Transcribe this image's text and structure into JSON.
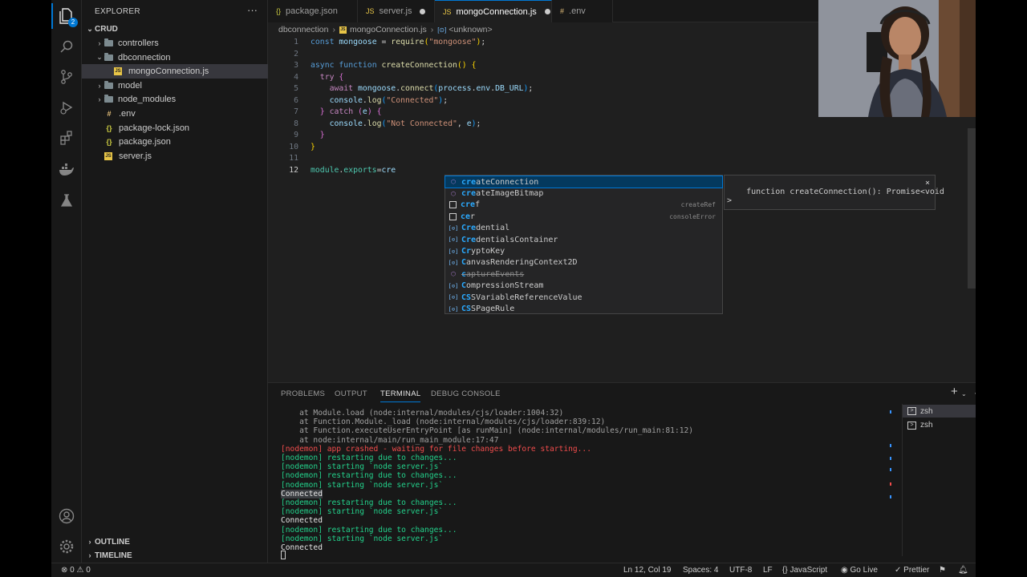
{
  "explorer": {
    "title": "EXPLORER",
    "more_label": "···",
    "badge_count": "2",
    "root_label": "CRUD",
    "items": [
      {
        "label": "controllers",
        "type": "folder",
        "expanded": false,
        "indent": 1
      },
      {
        "label": "dbconnection",
        "type": "folder",
        "expanded": true,
        "indent": 1
      },
      {
        "label": "mongoConnection.js",
        "type": "js",
        "indent": 2,
        "selected": true
      },
      {
        "label": "model",
        "type": "folder",
        "expanded": false,
        "indent": 1
      },
      {
        "label": "node_modules",
        "type": "folder",
        "expanded": false,
        "indent": 1
      },
      {
        "label": ".env",
        "type": "env",
        "indent": 1
      },
      {
        "label": "package-lock.json",
        "type": "json",
        "indent": 1
      },
      {
        "label": "package.json",
        "type": "json",
        "indent": 1
      },
      {
        "label": "server.js",
        "type": "js",
        "indent": 1
      }
    ],
    "outline_label": "OUTLINE",
    "timeline_label": "TIMELINE"
  },
  "tabs": [
    {
      "label": "package.json",
      "icon": "{}",
      "active": false,
      "dirty": false
    },
    {
      "label": "server.js",
      "icon": "JS",
      "active": false,
      "dirty": true
    },
    {
      "label": "mongoConnection.js",
      "icon": "JS",
      "active": true,
      "dirty": true
    },
    {
      "label": ".env",
      "icon": "#",
      "active": false,
      "dirty": false
    }
  ],
  "breadcrumb": {
    "folder": "dbconnection",
    "file": "mongoConnection.js",
    "symbol": "<unknown>"
  },
  "editor": {
    "cursor_line": 12,
    "lines": [
      {
        "n": "1",
        "tokens": [
          [
            "kw",
            "const"
          ],
          [
            "pl",
            " "
          ],
          [
            "var",
            "mongoose"
          ],
          [
            "pl",
            " = "
          ],
          [
            "fn",
            "require"
          ],
          [
            "br",
            "("
          ],
          [
            "str",
            "\"mongoose\""
          ],
          [
            "br",
            ")"
          ],
          [
            "pl",
            ";"
          ]
        ]
      },
      {
        "n": "2",
        "tokens": []
      },
      {
        "n": "3",
        "tokens": [
          [
            "kw",
            "async"
          ],
          [
            "pl",
            " "
          ],
          [
            "kw",
            "function"
          ],
          [
            "pl",
            " "
          ],
          [
            "fn",
            "createConnection"
          ],
          [
            "br",
            "()"
          ],
          [
            "pl",
            " "
          ],
          [
            "br",
            "{"
          ]
        ]
      },
      {
        "n": "4",
        "tokens": [
          [
            "pl",
            "  "
          ],
          [
            "kw2",
            "try"
          ],
          [
            "pl",
            " "
          ],
          [
            "br2",
            "{"
          ]
        ]
      },
      {
        "n": "5",
        "tokens": [
          [
            "pl",
            "    "
          ],
          [
            "kw2",
            "await"
          ],
          [
            "pl",
            " "
          ],
          [
            "var",
            "mongoose"
          ],
          [
            "pl",
            "."
          ],
          [
            "fn",
            "connect"
          ],
          [
            "br3",
            "("
          ],
          [
            "var",
            "process"
          ],
          [
            "pl",
            "."
          ],
          [
            "var",
            "env"
          ],
          [
            "pl",
            "."
          ],
          [
            "var",
            "DB_URL"
          ],
          [
            "br3",
            ")"
          ],
          [
            "pl",
            ";"
          ]
        ]
      },
      {
        "n": "6",
        "tokens": [
          [
            "pl",
            "    "
          ],
          [
            "var",
            "console"
          ],
          [
            "pl",
            "."
          ],
          [
            "fn",
            "log"
          ],
          [
            "br3",
            "("
          ],
          [
            "str",
            "\"Connected\""
          ],
          [
            "br3",
            ")"
          ],
          [
            "pl",
            ";"
          ]
        ]
      },
      {
        "n": "7",
        "tokens": [
          [
            "pl",
            "  "
          ],
          [
            "br2",
            "}"
          ],
          [
            "pl",
            " "
          ],
          [
            "kw2",
            "catch"
          ],
          [
            "pl",
            " "
          ],
          [
            "br2",
            "("
          ],
          [
            "var",
            "e"
          ],
          [
            "br2",
            ")"
          ],
          [
            "pl",
            " "
          ],
          [
            "br2",
            "{"
          ]
        ]
      },
      {
        "n": "8",
        "tokens": [
          [
            "pl",
            "    "
          ],
          [
            "var",
            "console"
          ],
          [
            "pl",
            "."
          ],
          [
            "fn",
            "log"
          ],
          [
            "br3",
            "("
          ],
          [
            "str",
            "\"Not Connected\""
          ],
          [
            "pl",
            ", "
          ],
          [
            "var",
            "e"
          ],
          [
            "br3",
            ")"
          ],
          [
            "pl",
            ";"
          ]
        ]
      },
      {
        "n": "9",
        "tokens": [
          [
            "pl",
            "  "
          ],
          [
            "br2",
            "}"
          ]
        ]
      },
      {
        "n": "10",
        "tokens": [
          [
            "br",
            "}"
          ]
        ]
      },
      {
        "n": "11",
        "tokens": []
      },
      {
        "n": "12",
        "tokens": [
          [
            "obj",
            "module"
          ],
          [
            "pl",
            "."
          ],
          [
            "obj",
            "exports"
          ],
          [
            "pl",
            "="
          ],
          [
            "var",
            "cre"
          ]
        ]
      }
    ]
  },
  "suggest": {
    "items": [
      {
        "match": "cre",
        "rest": "ateConnection",
        "icon": "cube",
        "detail": "",
        "selected": true,
        "strike": false
      },
      {
        "match": "cre",
        "rest": "ateImageBitmap",
        "icon": "cube",
        "detail": "",
        "selected": false,
        "strike": false
      },
      {
        "match": "cre",
        "rest": "f",
        "icon": "box",
        "detail": "createRef",
        "selected": false,
        "strike": false
      },
      {
        "match": "ce",
        "rest": "r",
        "icon": "box",
        "detail": "consoleError",
        "selected": false,
        "strike": false
      },
      {
        "match": "Cre",
        "rest": "dential",
        "icon": "var",
        "detail": "",
        "selected": false,
        "strike": false
      },
      {
        "match": "Cre",
        "rest": "dentialsContainer",
        "icon": "var",
        "detail": "",
        "selected": false,
        "strike": false
      },
      {
        "match": "Cr",
        "rest": "yptoKey",
        "icon": "var",
        "detail": "",
        "selected": false,
        "strike": false
      },
      {
        "match": "C",
        "rest": "anvasRenderingContext2D",
        "icon": "var",
        "detail": "",
        "selected": false,
        "strike": false
      },
      {
        "match": "c",
        "rest": "aptureEvents",
        "icon": "cube",
        "detail": "",
        "selected": false,
        "strike": true
      },
      {
        "match": "C",
        "rest": "ompressionStream",
        "icon": "var",
        "detail": "",
        "selected": false,
        "strike": false
      },
      {
        "match": "CS",
        "rest": "SVariableReferenceValue",
        "icon": "var",
        "detail": "",
        "selected": false,
        "strike": false
      },
      {
        "match": "CS",
        "rest": "SPageRule",
        "icon": "var",
        "detail": "",
        "selected": false,
        "strike": false
      }
    ],
    "detail_signature": "function createConnection(): Promise<void\n>",
    "close_label": "×"
  },
  "panel": {
    "tabs": [
      "PROBLEMS",
      "OUTPUT",
      "TERMINAL",
      "DEBUG CONSOLE"
    ],
    "active_tab": "TERMINAL",
    "terminal_lines": [
      {
        "text": "    at Module.load (node:internal/modules/cjs/loader:1004:32)",
        "style": "dim"
      },
      {
        "text": "    at Function.Module._load (node:internal/modules/cjs/loader:839:12)",
        "style": "dim"
      },
      {
        "text": "    at Function.executeUserEntryPoint [as runMain] (node:internal/modules/run_main:81:12)",
        "style": "dim"
      },
      {
        "text": "    at node:internal/main/run_main_module:17:47",
        "style": "dim"
      },
      {
        "text": "[nodemon] app crashed - waiting for file changes before starting...",
        "style": "red"
      },
      {
        "text": "[nodemon] restarting due to changes...",
        "style": "grn"
      },
      {
        "text": "[nodemon] starting `node server.js`",
        "style": "grn"
      },
      {
        "text": "[nodemon] restarting due to changes...",
        "style": "grn"
      },
      {
        "text": "[nodemon] starting `node server.js`",
        "style": "grn"
      },
      {
        "text": "Connected",
        "style": "hl"
      },
      {
        "text": "[nodemon] restarting due to changes...",
        "style": "grn"
      },
      {
        "text": "[nodemon] starting `node server.js`",
        "style": "grn"
      },
      {
        "text": "Connected",
        "style": "wht"
      },
      {
        "text": "[nodemon] restarting due to changes...",
        "style": "grn"
      },
      {
        "text": "[nodemon] starting `node server.js`",
        "style": "grn"
      },
      {
        "text": "Connected",
        "style": "wht"
      }
    ],
    "terminals": [
      {
        "label": "zsh",
        "selected": true
      },
      {
        "label": "zsh",
        "selected": false
      }
    ]
  },
  "status": {
    "problems": "⊗ 0 ⚠ 0",
    "position": "Ln 12, Col 19",
    "spaces": "Spaces: 4",
    "encoding": "UTF-8",
    "eol": "LF",
    "language": "{} JavaScript",
    "golive": "Go Live",
    "prettier": "✓ Prettier"
  },
  "colors": {
    "accent": "#0078d4",
    "editor_bg": "#1f1f1f",
    "sidebar_bg": "#181818"
  }
}
